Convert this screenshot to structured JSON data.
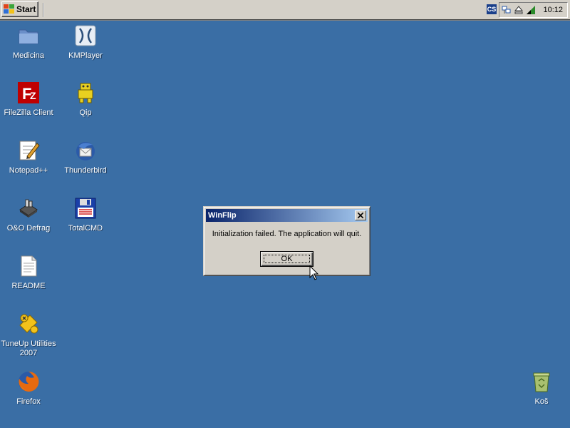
{
  "taskbar": {
    "start_label": "Start",
    "clock": "10:12",
    "tray_icons": [
      "cs-icon",
      "network-icon",
      "eject-icon",
      "volume-icon"
    ],
    "cs_text": "CS"
  },
  "desktop": {
    "background": "#3a6ea5",
    "icons": [
      {
        "label": "Medicina",
        "icon": "folder-icon"
      },
      {
        "label": "KMPlayer",
        "icon": "kmplayer-icon"
      },
      {
        "label": "FileZilla Client",
        "icon": "filezilla-icon"
      },
      {
        "label": "Qip",
        "icon": "qip-icon"
      },
      {
        "label": "Notepad++",
        "icon": "notepad-icon"
      },
      {
        "label": "Thunderbird",
        "icon": "thunderbird-icon"
      },
      {
        "label": "O&O Defrag",
        "icon": "defrag-icon"
      },
      {
        "label": "TotalCMD",
        "icon": "totalcmd-icon"
      },
      {
        "label": "README",
        "icon": "document-icon"
      },
      {
        "label": "TuneUp Utilities 2007",
        "icon": "tuneup-icon"
      },
      {
        "label": "Firefox",
        "icon": "firefox-icon"
      },
      {
        "label": "Koš",
        "icon": "recycle-bin-icon"
      }
    ]
  },
  "dialog": {
    "title": "WinFlip",
    "message": "Initialization failed. The application will quit.",
    "ok_label": "OK"
  }
}
